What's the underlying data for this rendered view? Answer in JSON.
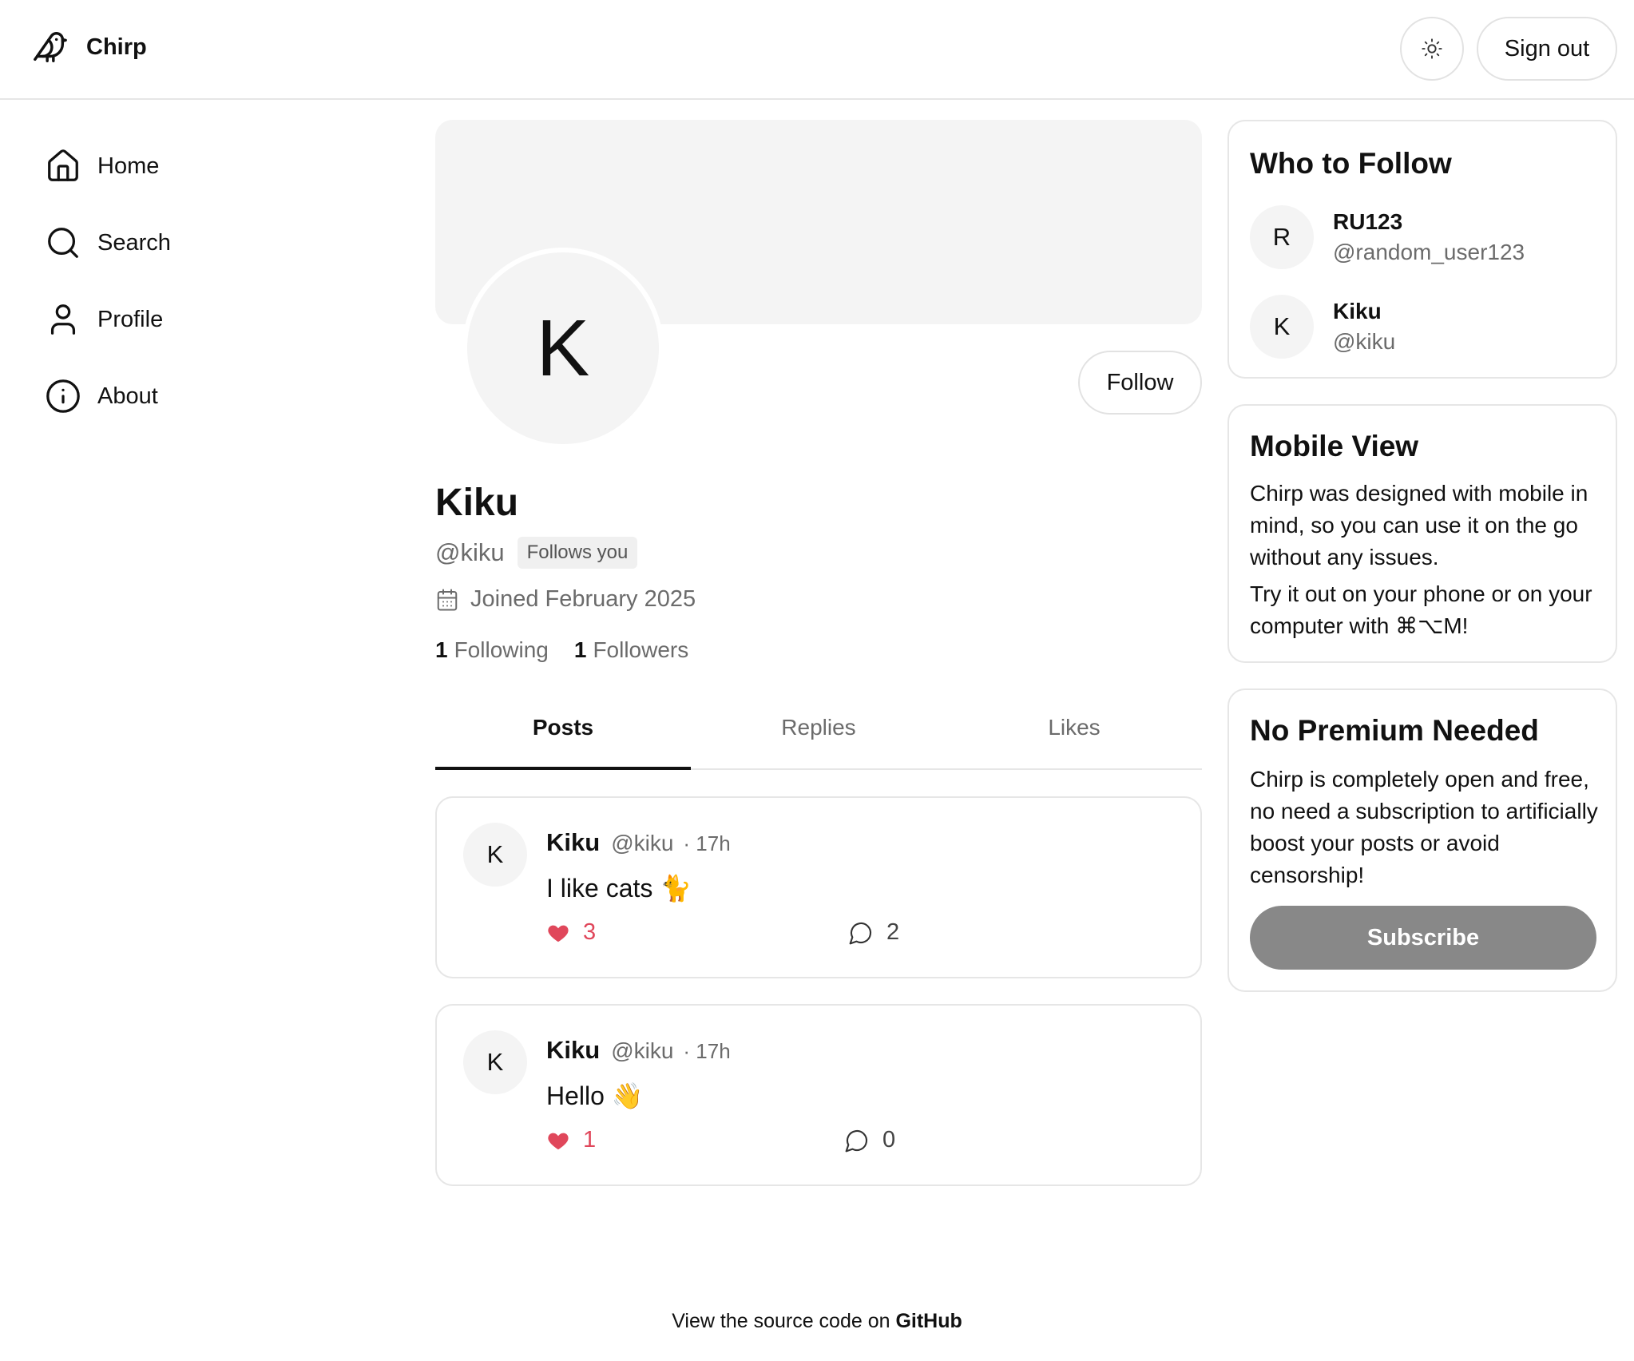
{
  "app": {
    "name": "Chirp"
  },
  "header": {
    "sign_out_label": "Sign out",
    "theme_icon": "sun-icon"
  },
  "sidebar": {
    "items": [
      {
        "label": "Home",
        "icon": "home-icon"
      },
      {
        "label": "Search",
        "icon": "search-icon"
      },
      {
        "label": "Profile",
        "icon": "user-icon"
      },
      {
        "label": "About",
        "icon": "info-icon"
      }
    ]
  },
  "profile": {
    "avatar_letter": "K",
    "name": "Kiku",
    "handle": "@kiku",
    "follows_you": "Follows you",
    "joined": "Joined February 2025",
    "following_count": "1",
    "following_label": "Following",
    "followers_count": "1",
    "followers_label": "Followers",
    "follow_button": "Follow"
  },
  "tabs": [
    {
      "label": "Posts",
      "active": true
    },
    {
      "label": "Replies",
      "active": false
    },
    {
      "label": "Likes",
      "active": false
    }
  ],
  "posts": [
    {
      "avatar": "K",
      "name": "Kiku",
      "handle": "@kiku",
      "time": "· 17h",
      "text": "I like cats 🐈",
      "likes": "3",
      "replies": "2"
    },
    {
      "avatar": "K",
      "name": "Kiku",
      "handle": "@kiku",
      "time": "· 17h",
      "text": "Hello 👋",
      "likes": "1",
      "replies": "0"
    }
  ],
  "who_to_follow": {
    "title": "Who to Follow",
    "users": [
      {
        "avatar": "R",
        "name": "RU123",
        "handle": "@random_user123"
      },
      {
        "avatar": "K",
        "name": "Kiku",
        "handle": "@kiku"
      }
    ]
  },
  "mobile_view": {
    "title": "Mobile View",
    "text1": "Chirp was designed with mobile in mind, so you can use it on the go without any issues.",
    "text2": "Try it out on your phone or on your computer with ⌘⌥M!"
  },
  "premium": {
    "title": "No Premium Needed",
    "text": "Chirp is completely open and free, no need a subscription to artificially boost your posts or avoid censorship!",
    "button": "Subscribe"
  },
  "footer": {
    "text": "View the source code on",
    "link": "GitHub"
  },
  "colors": {
    "like": "#e0475b",
    "subscribe_bg": "#888888",
    "banner_bg": "#f4f4f4"
  }
}
